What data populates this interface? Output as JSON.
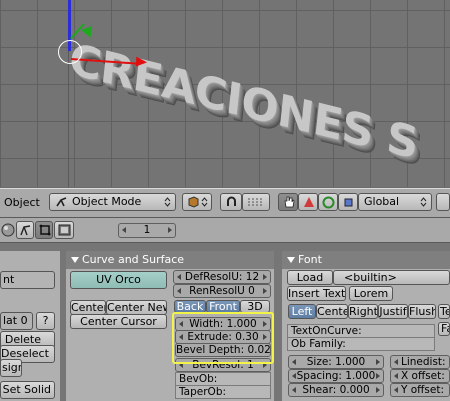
{
  "viewport": {
    "text_object": "CREACIONES S"
  },
  "header": {
    "object_menu": "Object",
    "mode_select": "Object Mode",
    "layer_number": "1",
    "orientation": "Global"
  },
  "curve_panel": {
    "title": "Curve and Surface",
    "uv_orco": "UV Orco",
    "def_resol_u": "DefResolU: 12",
    "ren_resol_u": "RenResolU 0",
    "center": "Center",
    "center_new": "Center New",
    "center_cursor": "Center Cursor",
    "back": "Back",
    "front": "Front",
    "threed": "3D",
    "width": "Width: 1.000",
    "extrude": "Extrude: 0.30",
    "bevel_depth": "Bevel Depth: 0.020",
    "bev_resol": "BevResol: 1",
    "bev_ob": "BevOb:",
    "taper_ob": "TaperOb:"
  },
  "font_panel": {
    "title": "Font",
    "load": "Load",
    "builtin": "<builtin>",
    "insert_text": "Insert Text",
    "lorem": "Lorem",
    "align_left": "Left",
    "align_center": "Cente",
    "align_right": "Right",
    "align_justify": "Justif",
    "align_flush": "Flush",
    "tex": "Te",
    "text_on_curve": "TextOnCurve:",
    "ob_family": "Ob Family:",
    "fa": "Fa",
    "size": "Size: 1.000",
    "spacing": "Spacing: 1.000",
    "shear": "Shear: 0.000",
    "linedist": "Linedist: 1",
    "x_offset": "X offset:",
    "y_offset": "Y offset:"
  },
  "left_panel": {
    "item_ent": "nt",
    "mat": "lat 0",
    "question": "?",
    "delete": "Delete",
    "deselect": "Deselect",
    "sign": "sign",
    "set_solid": "Set Solid"
  }
}
